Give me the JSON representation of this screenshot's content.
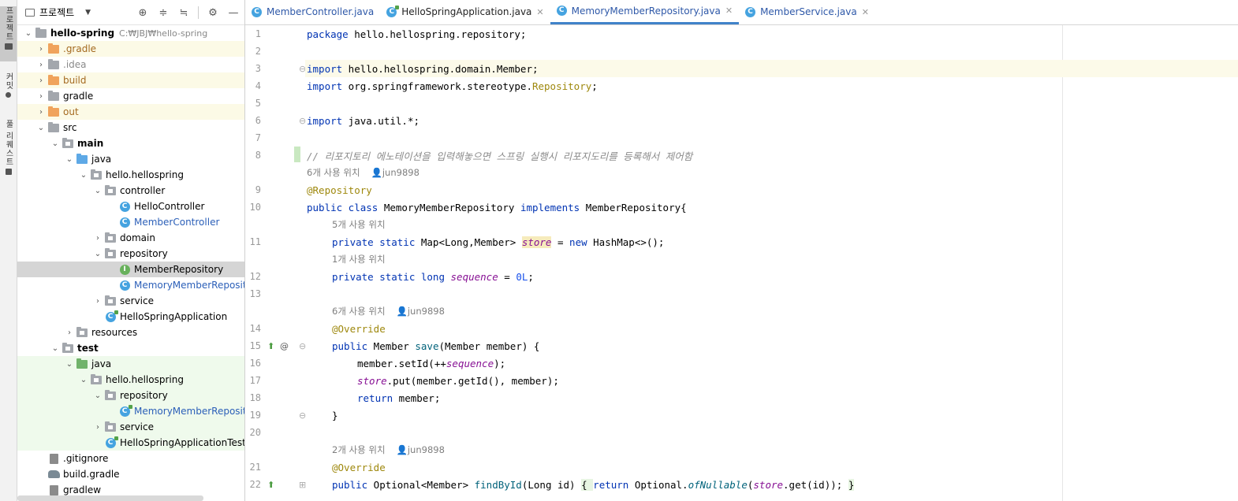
{
  "toolstrip": {
    "project": "프로젝트",
    "commit": "커밋",
    "pull_requests": "풀 리퀘스트"
  },
  "project_panel": {
    "title": "프로젝트",
    "root_name": "hello-spring",
    "root_path": "C:₩JBJ₩hello-spring",
    "items": [
      {
        "label": ".gradle"
      },
      {
        "label": ".idea"
      },
      {
        "label": "build"
      },
      {
        "label": "gradle"
      },
      {
        "label": "out"
      },
      {
        "label": "src"
      },
      {
        "label": "main"
      },
      {
        "label": "java"
      },
      {
        "label": "hello.hellospring"
      },
      {
        "label": "controller"
      },
      {
        "label": "HelloController"
      },
      {
        "label": "MemberController"
      },
      {
        "label": "domain"
      },
      {
        "label": "repository"
      },
      {
        "label": "MemberRepository"
      },
      {
        "label": "MemoryMemberRepository"
      },
      {
        "label": "service"
      },
      {
        "label": "HelloSpringApplication"
      },
      {
        "label": "resources"
      },
      {
        "label": "test"
      },
      {
        "label": "java"
      },
      {
        "label": "hello.hellospring"
      },
      {
        "label": "repository"
      },
      {
        "label": "MemoryMemberRepositoryTest"
      },
      {
        "label": "service"
      },
      {
        "label": "HelloSpringApplicationTests"
      },
      {
        "label": ".gitignore"
      },
      {
        "label": "build.gradle"
      },
      {
        "label": "gradlew"
      }
    ]
  },
  "tabs": [
    {
      "label": "MemberController.java"
    },
    {
      "label": "HelloSpringApplication.java"
    },
    {
      "label": "MemoryMemberRepository.java"
    },
    {
      "label": "MemberService.java"
    }
  ],
  "editor": {
    "line_numbers": [
      "1",
      "2",
      "3",
      "4",
      "5",
      "6",
      "7",
      "8",
      "9",
      "10",
      "11",
      "12",
      "13",
      "14",
      "15",
      "16",
      "17",
      "18",
      "19",
      "20",
      "21",
      "22"
    ],
    "code": {
      "l1_kw": "package",
      "l1_rest": " hello.hellospring.repository;",
      "l3_kw": "import",
      "l3_rest": " hello.hellospring.domain.Member;",
      "l4_kw": "import",
      "l4_rest": " org.springframework.stereotype.",
      "l4_ann": "Repository",
      "l4_end": ";",
      "l6_kw": "import",
      "l6_rest": " java.util.*;",
      "l8_comment": "// 리포지토리 에노테이션을 입력해놓으면 스프링 실행시 리포지도리를 등록해서 제어함",
      "l9_ann": "@Repository",
      "l10_kw1": "public class",
      "l10_name": " MemoryMemberRepository ",
      "l10_kw2": "implements",
      "l10_rest": " MemberRepository{",
      "l11_kw": "private static",
      "l11_type": " Map<Long,Member> ",
      "l11_field": "store",
      "l11_eq": " = ",
      "l11_new": "new",
      "l11_rest": " HashMap<>();",
      "l12_kw": "private static long",
      "l12_field": "sequence",
      "l12_eq": " = ",
      "l12_num": "0L",
      "l12_end": ";",
      "l14_ann": "@Override",
      "l15_kw": "public",
      "l15_type": " Member ",
      "l15_fn": "save",
      "l15_rest": "(Member member) {",
      "l16_a": "member.setId(++",
      "l16_field": "sequence",
      "l16_b": ");",
      "l17_field": "store",
      "l17_rest": ".put(member.getId(), member);",
      "l18_kw": "return",
      "l18_rest": " member;",
      "l19": "}",
      "l21_ann": "@Override",
      "l22_kw": "public",
      "l22_type": " Optional<Member> ",
      "l22_fn": "findById",
      "l22_args": "(Long id) ",
      "l22_brace1": "{ ",
      "l22_ret": "return",
      "l22_opt": " Optional.",
      "l22_call": "ofNullable",
      "l22_paren": "(",
      "l22_field": "store",
      "l22_tail": ".get(id)); ",
      "l22_brace2": "}"
    },
    "hints": {
      "h9_usages": "6개 사용 위치",
      "h9_author": "jun9898",
      "h11_usages": "5개 사용 위치",
      "h12_usages": "1개 사용 위치",
      "h14_usages": "6개 사용 위치",
      "h14_author": "jun9898",
      "h21_usages": "2개 사용 위치",
      "h21_author": "jun9898"
    }
  }
}
